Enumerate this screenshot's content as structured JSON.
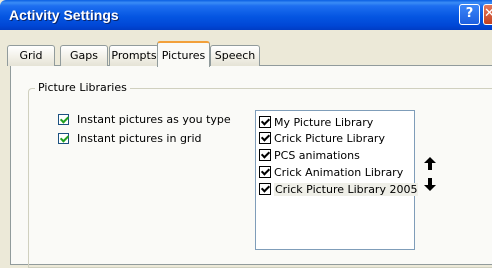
{
  "window": {
    "title": "Activity Settings",
    "help_glyph": "?",
    "close_glyph": "✕"
  },
  "tabs": [
    {
      "label": "Grid",
      "active": false
    },
    {
      "label": "Gaps",
      "active": false
    },
    {
      "label": "Prompts",
      "active": false
    },
    {
      "label": "Pictures",
      "active": true
    },
    {
      "label": "Speech",
      "active": false
    }
  ],
  "group": {
    "title": "Picture Libraries"
  },
  "options": [
    {
      "label": "Instant pictures as you type",
      "checked": true
    },
    {
      "label": "Instant pictures in grid",
      "checked": true
    }
  ],
  "libraries": [
    {
      "label": "My Picture Library",
      "checked": true,
      "selected": false
    },
    {
      "label": "Crick Picture Library",
      "checked": true,
      "selected": false
    },
    {
      "label": "PCS animations",
      "checked": true,
      "selected": false
    },
    {
      "label": "Crick Animation Library",
      "checked": true,
      "selected": false
    },
    {
      "label": "Crick Picture Library 2005",
      "checked": true,
      "selected": true
    }
  ],
  "reorder": {
    "up_icon": "arrow-up-icon",
    "down_icon": "arrow-down-icon"
  },
  "colors": {
    "titlebar": "#0556e2",
    "dialog_bg": "#ece9d8",
    "panel_bg": "#fafaf7",
    "active_tab_accent": "#f2a03a"
  }
}
